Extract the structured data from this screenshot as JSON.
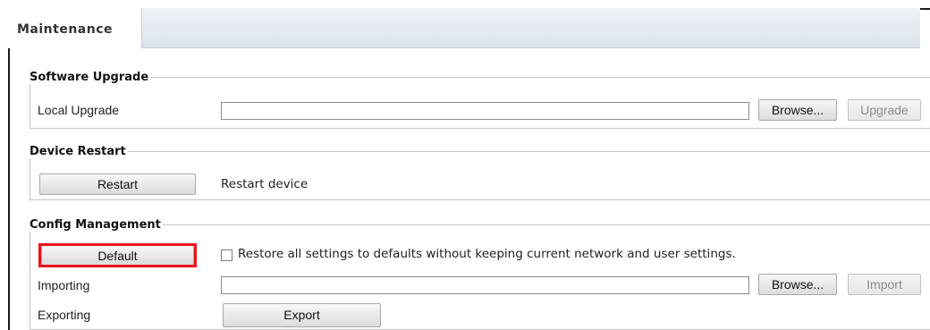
{
  "tab": {
    "label": "Maintenance"
  },
  "software_upgrade": {
    "legend": "Software Upgrade",
    "local_upgrade_label": "Local Upgrade",
    "file_value": "",
    "browse_label": "Browse...",
    "upgrade_label": "Upgrade"
  },
  "device_restart": {
    "legend": "Device Restart",
    "restart_label": "Restart",
    "description": "Restart device"
  },
  "config_management": {
    "legend": "Config Management",
    "default_label": "Default",
    "restore_checkbox_label": "Restore all settings to defaults without keeping current network and user settings.",
    "restore_checked": false,
    "importing_label": "Importing",
    "import_file_value": "",
    "browse_label": "Browse...",
    "import_label": "Import",
    "exporting_label": "Exporting",
    "export_label": "Export"
  },
  "colors": {
    "highlight": "#e8141b",
    "tab_bar": "#dde4eb"
  }
}
